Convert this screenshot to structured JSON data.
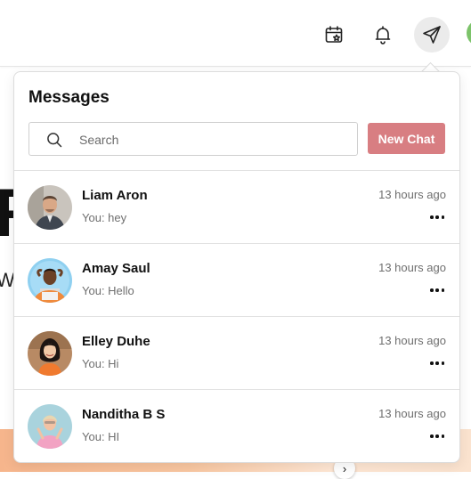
{
  "header": {
    "icons": [
      "calendar-star-icon",
      "bell-icon",
      "send-icon"
    ]
  },
  "messages": {
    "title": "Messages",
    "search_placeholder": "Search",
    "search_value": "",
    "new_chat_label": "New Chat",
    "conversations": [
      {
        "name": "Liam Aron",
        "preview": "You: hey",
        "time": "13 hours ago"
      },
      {
        "name": "Amay Saul",
        "preview": "You: Hello",
        "time": "13 hours ago"
      },
      {
        "name": "Elley Duhe",
        "preview": "You: Hi",
        "time": "13 hours ago"
      },
      {
        "name": "Nanditha B S",
        "preview": "You: HI",
        "time": "13 hours ago"
      }
    ]
  },
  "background": {
    "letter": "R",
    "letter2": "W",
    "chevron": "›"
  },
  "colors": {
    "accent": "#d87e82",
    "muted_text": "#6f6f6f",
    "border": "#e2e2e2"
  }
}
